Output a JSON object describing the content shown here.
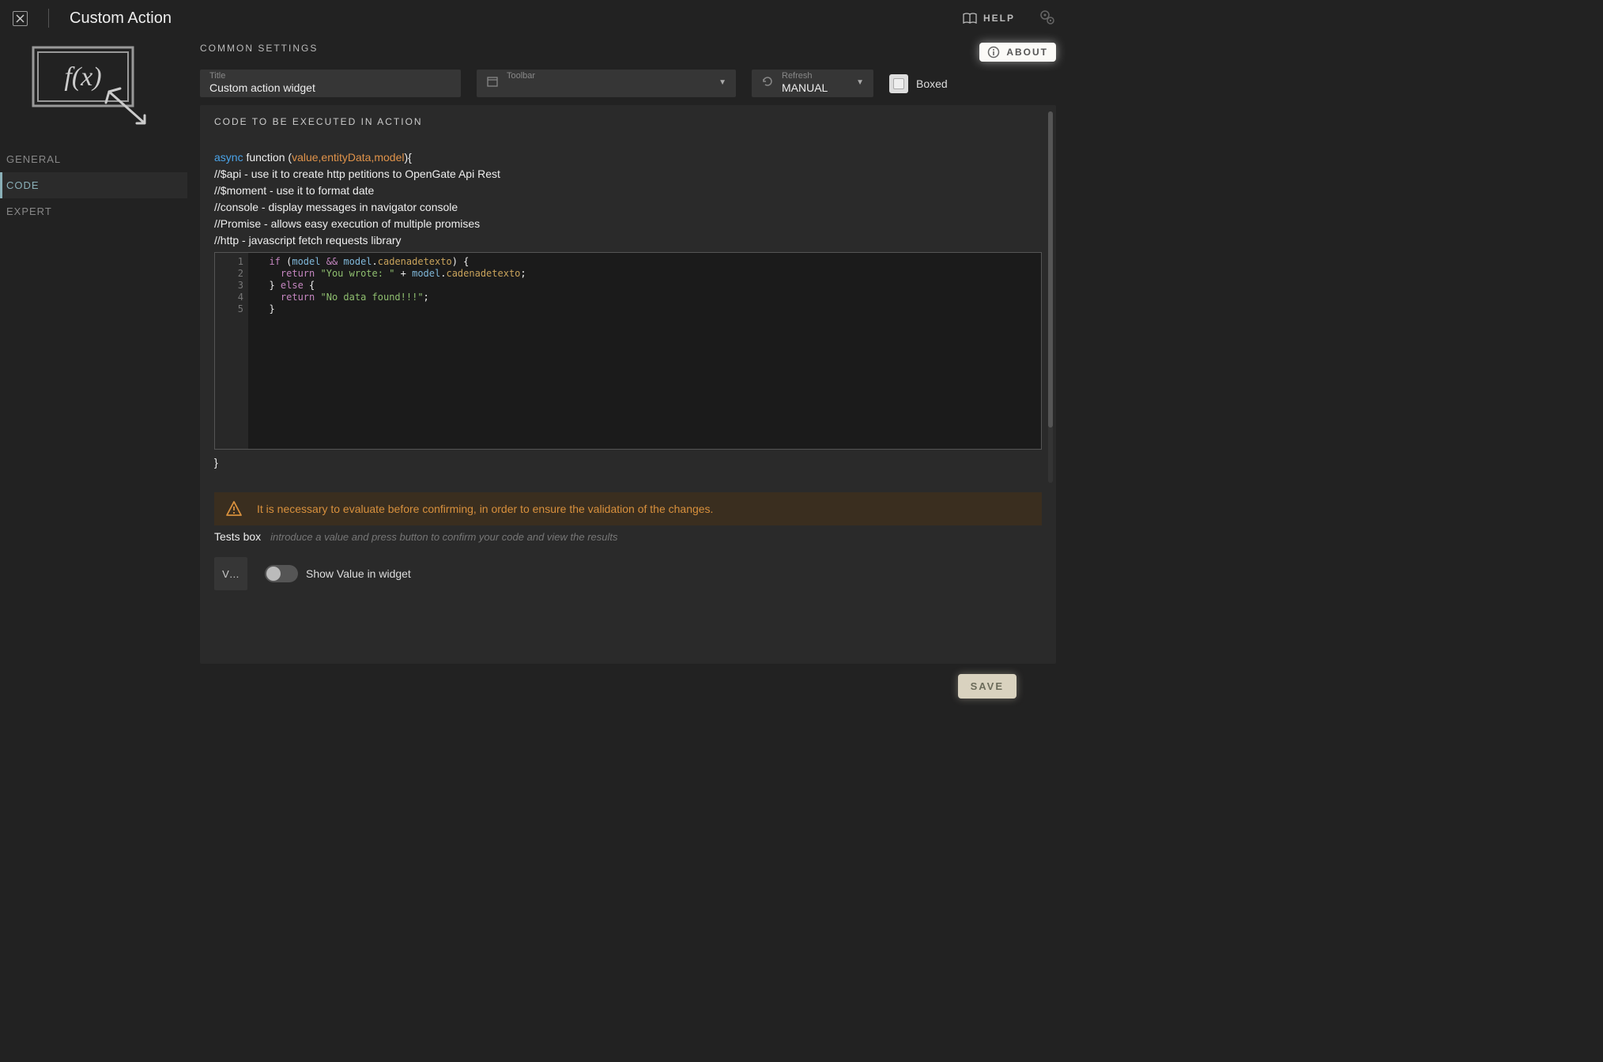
{
  "header": {
    "title": "Custom Action",
    "help_label": "HELP"
  },
  "sidebar": {
    "tabs": [
      {
        "label": "GENERAL"
      },
      {
        "label": "CODE"
      },
      {
        "label": "EXPERT"
      }
    ]
  },
  "settings": {
    "section_label": "COMMON SETTINGS",
    "about_label": "ABOUT",
    "title_label": "Title",
    "title_value": "Custom action widget",
    "toolbar_label": "Toolbar",
    "refresh_label": "Refresh",
    "refresh_value": "MANUAL",
    "boxed_label": "Boxed"
  },
  "code": {
    "section_label": "CODE TO BE EXECUTED IN ACTION",
    "signature": {
      "kw": "async",
      "func": "function (",
      "params": "value,entityData,model",
      "close": "){"
    },
    "comments": [
      "//$api - use it to create http petitions to OpenGate Api Rest",
      "//$moment - use it to format date",
      "//console - display messages in navigator console",
      "//Promise - allows easy execution of multiple promises",
      "//http - javascript fetch requests library"
    ],
    "editor_lines": [
      "  if (model && model.cadenadetexto) {",
      "    return \"You wrote: \" + model.cadenadetexto;",
      "  } else {",
      "    return \"No data found!!!\";",
      "  }"
    ],
    "closing_brace": "}",
    "warn": "It is necessary to evaluate before confirming, in order to ensure the validation of the changes.",
    "tests_label": "Tests box",
    "tests_hint": "introduce a value and press button to confirm your code and view the results",
    "v_label": "V…",
    "show_value_label": "Show Value in widget"
  },
  "footer": {
    "save_label": "SAVE"
  }
}
